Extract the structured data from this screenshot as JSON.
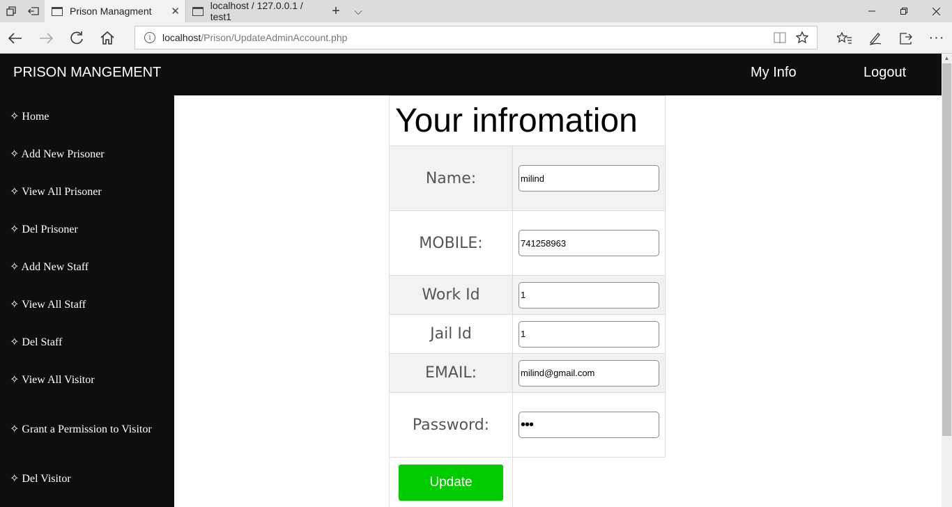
{
  "browser": {
    "tabs": [
      {
        "title": "Prison Managment",
        "active": true
      },
      {
        "title": "localhost / 127.0.0.1 / test1",
        "active": false
      }
    ],
    "new_tab_glyph": "+",
    "tab_list_glyph": "⌵",
    "address": {
      "host": "localhost",
      "path": "/Prison/UpdateAdminAccount.php"
    }
  },
  "site": {
    "brand": "PRISON MANGEMENT",
    "top_links": {
      "my_info": "My Info",
      "logout": "Logout"
    },
    "sidebar": {
      "bullet": "✧",
      "items": [
        {
          "label": "Home"
        },
        {
          "label": "Add New Prisoner"
        },
        {
          "label": "View All Prisoner"
        },
        {
          "label": "Del Prisoner"
        },
        {
          "label": "Add New Staff"
        },
        {
          "label": "View All Staff"
        },
        {
          "label": "Del Staff"
        },
        {
          "label": "View All Visitor"
        },
        {
          "label": "Grant a Permission to Visitor"
        },
        {
          "label": "Del Visitor"
        }
      ]
    }
  },
  "form": {
    "heading": "Your infromation",
    "fields": [
      {
        "label": "Name:",
        "value": "milind"
      },
      {
        "label": "MOBILE:",
        "value": "741258963"
      },
      {
        "label": "Work Id",
        "value": "1"
      },
      {
        "label": "Jail Id",
        "value": "1"
      },
      {
        "label": "EMAIL:",
        "value": "milind@gmail.com"
      },
      {
        "label": "Password:",
        "value": "123"
      }
    ],
    "submit_label": "Update"
  },
  "colors": {
    "header_bg": "#0e0e0e",
    "sidebar_bg": "#0e0e0e",
    "update_button": "#00cc00",
    "row_shade": "#f2f2f2"
  }
}
